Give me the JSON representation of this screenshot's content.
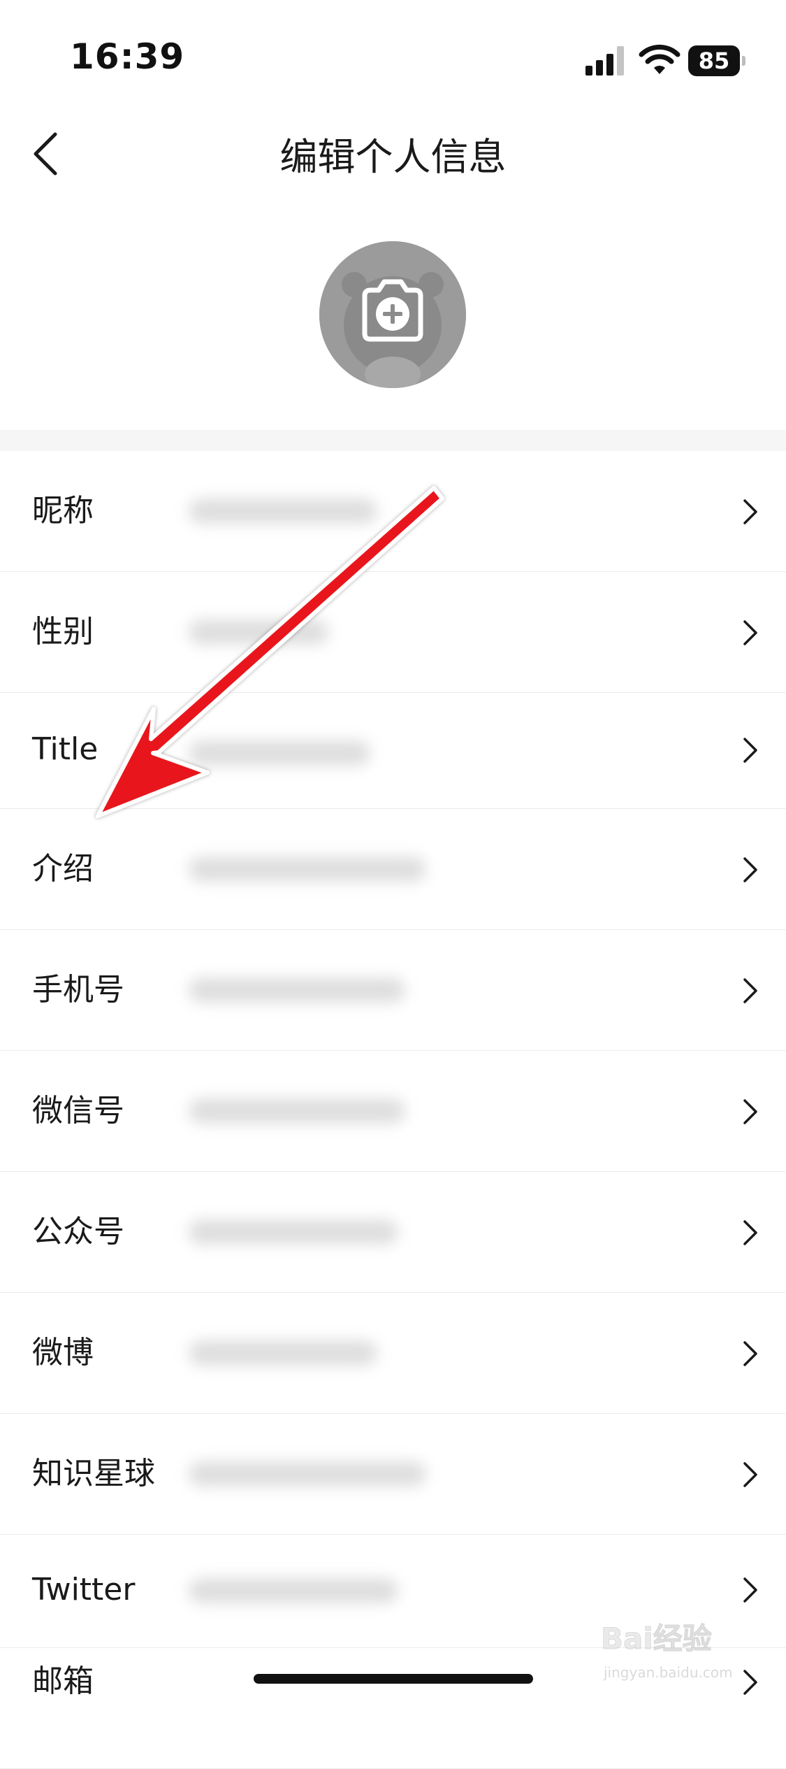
{
  "status_bar": {
    "time": "16:39",
    "battery": "85",
    "icons": [
      "signal-icon",
      "wifi-icon",
      "battery-icon"
    ]
  },
  "nav": {
    "title": "编辑个人信息",
    "back_icon": "chevron-left-icon"
  },
  "avatar": {
    "icon": "camera-plus-icon"
  },
  "items": [
    {
      "label": "昵称"
    },
    {
      "label": "性别"
    },
    {
      "label": "Title"
    },
    {
      "label": "介绍"
    },
    {
      "label": "手机号"
    },
    {
      "label": "微信号"
    },
    {
      "label": "公众号"
    },
    {
      "label": "微博"
    },
    {
      "label": "知识星球"
    },
    {
      "label": "Twitter"
    },
    {
      "label": "邮箱"
    }
  ],
  "annotation": {
    "type": "red-arrow",
    "color": "#e8141b"
  },
  "watermark": {
    "text": "Bai经验",
    "sub": "jingyan.baidu.com"
  }
}
